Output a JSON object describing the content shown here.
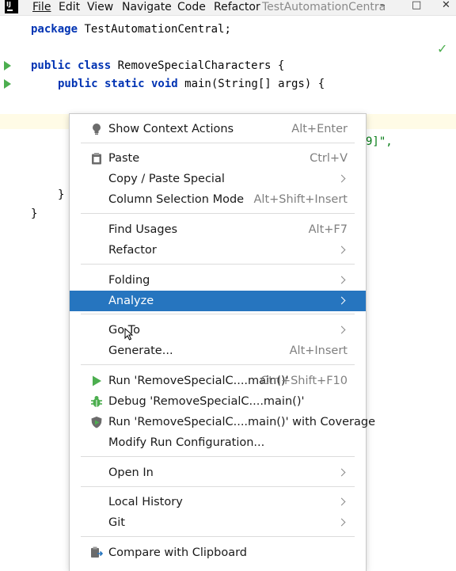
{
  "menubar": {
    "items": [
      "File",
      "Edit",
      "View",
      "Navigate",
      "Code",
      "Refactor"
    ],
    "window_title": "TestAutomationCentra"
  },
  "editor": {
    "package_keyword": "package",
    "package_name": " TestAutomationCentral;",
    "class_modifiers": "public class",
    "class_decl": " RemoveSpecialCharacters {",
    "method_modifiers": "public static void",
    "method_decl": " main(String[] args) {",
    "hidden_string_fragment": "9]\",",
    "method_close": "}",
    "class_close": "}"
  },
  "context_menu": {
    "items": [
      {
        "label": "Show Context Actions",
        "shortcut": "Alt+Enter",
        "icon": "lightbulb-icon"
      },
      {
        "label": "Paste",
        "shortcut": "Ctrl+V",
        "icon": "clipboard-icon"
      },
      {
        "label": "Copy / Paste Special",
        "submenu": true
      },
      {
        "label": "Column Selection Mode",
        "shortcut": "Alt+Shift+Insert"
      },
      {
        "label": "Find Usages",
        "shortcut": "Alt+F7"
      },
      {
        "label": "Refactor",
        "submenu": true
      },
      {
        "label": "Folding",
        "submenu": true
      },
      {
        "label": "Analyze",
        "submenu": true,
        "selected": true
      },
      {
        "label": "Go To",
        "submenu": true
      },
      {
        "label": "Generate...",
        "shortcut": "Alt+Insert"
      },
      {
        "label": "Run 'RemoveSpecialC....main()'",
        "shortcut": "Ctrl+Shift+F10",
        "icon": "run-icon"
      },
      {
        "label": "Debug 'RemoveSpecialC....main()'",
        "icon": "debug-bug-icon"
      },
      {
        "label": "Run 'RemoveSpecialC....main()' with Coverage",
        "icon": "coverage-shield-icon"
      },
      {
        "label": "Modify Run Configuration..."
      },
      {
        "label": "Open In",
        "submenu": true
      },
      {
        "label": "Local History",
        "submenu": true
      },
      {
        "label": "Git",
        "submenu": true
      },
      {
        "label": "Compare with Clipboard",
        "icon": "compare-clipboard-icon"
      }
    ]
  },
  "colors": {
    "selection": "#2675bf",
    "keyword": "#0033b3",
    "run_green": "#4cae4f"
  }
}
